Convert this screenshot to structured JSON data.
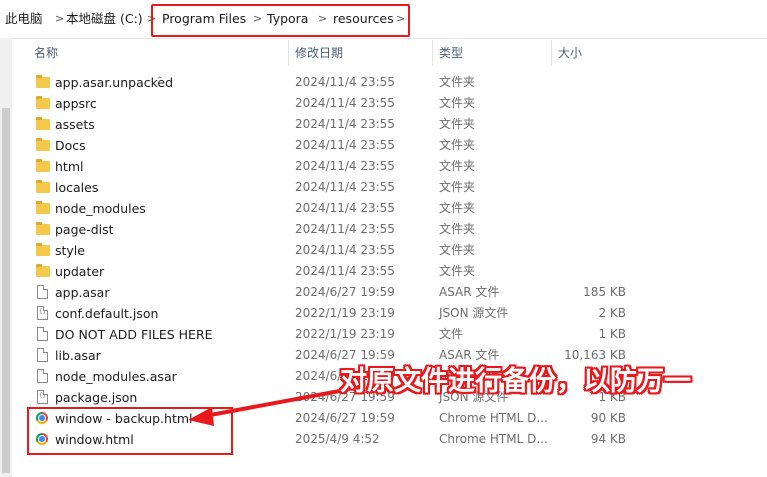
{
  "breadcrumb": {
    "items": [
      "此电脑",
      "本地磁盘 (C:)",
      "Program Files",
      "Typora",
      "resources"
    ],
    "separator": ">"
  },
  "columns": {
    "name": "名称",
    "date": "修改日期",
    "type": "类型",
    "size": "大小"
  },
  "files": [
    {
      "name": "app.asar.unpacked",
      "date": "2024/11/4 23:55",
      "type": "文件夹",
      "size": "",
      "icon": "folder-icon"
    },
    {
      "name": "appsrc",
      "date": "2024/11/4 23:55",
      "type": "文件夹",
      "size": "",
      "icon": "folder-icon"
    },
    {
      "name": "assets",
      "date": "2024/11/4 23:55",
      "type": "文件夹",
      "size": "",
      "icon": "folder-icon"
    },
    {
      "name": "Docs",
      "date": "2024/11/4 23:55",
      "type": "文件夹",
      "size": "",
      "icon": "folder-icon"
    },
    {
      "name": "html",
      "date": "2024/11/4 23:55",
      "type": "文件夹",
      "size": "",
      "icon": "folder-icon"
    },
    {
      "name": "locales",
      "date": "2024/11/4 23:55",
      "type": "文件夹",
      "size": "",
      "icon": "folder-icon"
    },
    {
      "name": "node_modules",
      "date": "2024/11/4 23:55",
      "type": "文件夹",
      "size": "",
      "icon": "folder-icon"
    },
    {
      "name": "page-dist",
      "date": "2024/11/4 23:55",
      "type": "文件夹",
      "size": "",
      "icon": "folder-icon"
    },
    {
      "name": "style",
      "date": "2024/11/4 23:55",
      "type": "文件夹",
      "size": "",
      "icon": "folder-icon"
    },
    {
      "name": "updater",
      "date": "2024/11/4 23:55",
      "type": "文件夹",
      "size": "",
      "icon": "folder-icon"
    },
    {
      "name": "app.asar",
      "date": "2024/6/27 19:59",
      "type": "ASAR 文件",
      "size": "185 KB",
      "icon": "file-icon"
    },
    {
      "name": "conf.default.json",
      "date": "2022/1/19 23:19",
      "type": "JSON 源文件",
      "size": "2 KB",
      "icon": "json-file-icon"
    },
    {
      "name": "DO NOT ADD FILES HERE",
      "date": "2022/1/19 23:19",
      "type": "文件",
      "size": "1 KB",
      "icon": "file-icon"
    },
    {
      "name": "lib.asar",
      "date": "2024/6/27 19:59",
      "type": "ASAR 文件",
      "size": "10,163 KB",
      "icon": "file-icon"
    },
    {
      "name": "node_modules.asar",
      "date": "2024/6/27 19:59",
      "type": "ASAR 文件",
      "size": "0 KB",
      "icon": "file-icon"
    },
    {
      "name": "package.json",
      "date": "2024/6/27 19:59",
      "type": "JSON 源文件",
      "size": "1 KB",
      "icon": "json-file-icon"
    },
    {
      "name": "window - backup.html",
      "date": "2024/6/27 19:59",
      "type": "Chrome HTML D...",
      "size": "90 KB",
      "icon": "chrome-icon"
    },
    {
      "name": "window.html",
      "date": "2025/4/9 4:52",
      "type": "Chrome HTML D...",
      "size": "94 KB",
      "icon": "chrome-icon"
    }
  ],
  "annotation": {
    "text": "对原文件进行备份，以防万一",
    "color": "#e8191c"
  }
}
